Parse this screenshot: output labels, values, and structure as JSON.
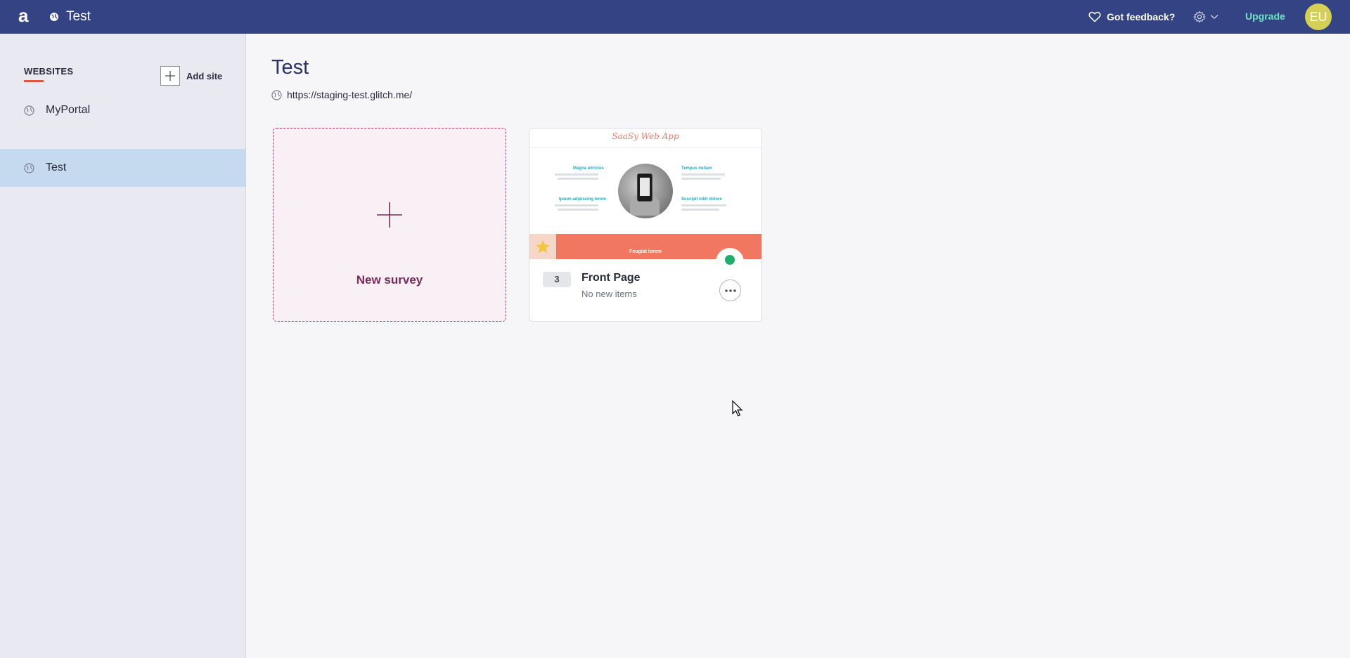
{
  "topbar": {
    "logo": "a",
    "current_site": "Test",
    "feedback_label": "Got feedback?",
    "upgrade_label": "Upgrade",
    "avatar_initials": "EU",
    "colors": {
      "bar": "#344384",
      "upgrade": "#6be2c2",
      "avatar": "#d6cf55"
    }
  },
  "sidebar": {
    "heading": "WEBSITES",
    "add_site_label": "Add site",
    "items": [
      {
        "label": "MyPortal",
        "active": false
      },
      {
        "label": "Test",
        "active": true
      }
    ]
  },
  "main": {
    "title": "Test",
    "url": "https://staging-test.glitch.me/",
    "new_survey_label": "New survey",
    "survey_card": {
      "count": "3",
      "title": "Front Page",
      "subtitle": "No new items",
      "status_color": "#1cae6a",
      "thumbnail": {
        "brand": "SaaSy Web App",
        "features": [
          "Magna ultricies",
          "Tempus nullam",
          "Ipsum adipiscing lorem",
          "Suscipit nibh dolore"
        ],
        "band_text": "Feugiat lorem"
      }
    }
  }
}
